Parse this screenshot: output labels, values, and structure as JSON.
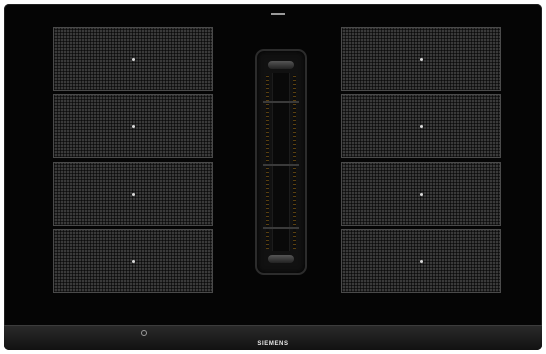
{
  "image": {
    "subject": "induction-hob-with-integrated-downdraft-vent",
    "brand_label": "SIEMENS",
    "corner_logo_lines": [
      "",
      "",
      ""
    ],
    "zone_label_left": "",
    "zone_label_right": "",
    "left_zones": [
      {
        "name": "left-zone-1"
      },
      {
        "name": "left-zone-2"
      },
      {
        "name": "left-zone-3"
      },
      {
        "name": "left-zone-4"
      }
    ],
    "right_zones": [
      {
        "name": "right-zone-1"
      },
      {
        "name": "right-zone-2"
      },
      {
        "name": "right-zone-3"
      },
      {
        "name": "right-zone-4"
      }
    ],
    "icons": [
      "power-icon",
      "zone-marker-icon"
    ],
    "colors": {
      "glass": "#050505",
      "zone_grid": "#3a3a3a",
      "marker": "#d8d8d8",
      "vent_amber": "#5a4010"
    }
  }
}
